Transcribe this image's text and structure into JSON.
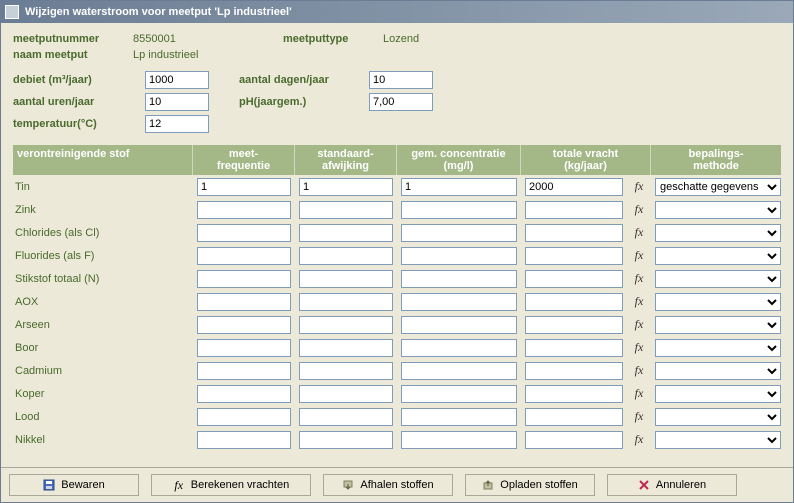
{
  "window": {
    "title": "Wijzigen waterstroom voor meetput 'Lp industrieel'"
  },
  "meta": {
    "meetputnummer_label": "meetputnummer",
    "meetputnummer": "8550001",
    "meetputtype_label": "meetputtype",
    "meetputtype": "Lozend",
    "naam_meetput_label": "naam meetput",
    "naam_meetput": "Lp industrieel",
    "debiet_label": "debiet (m³/jaar)",
    "debiet": "1000",
    "aantal_dagen_label": "aantal dagen/jaar",
    "aantal_dagen": "10",
    "aantal_uren_label": "aantal uren/jaar",
    "aantal_uren": "10",
    "ph_label": "pH(jaargem.)",
    "ph": "7,00",
    "temperatuur_label": "temperatuur(°C)",
    "temperatuur": "12"
  },
  "columns": {
    "stof": "verontreinigende stof",
    "freq": "meet-\nfrequentie",
    "afw": "standaard-\nafwijking",
    "conc": "gem. concentratie\n(mg/l)",
    "vracht": "totale vracht\n(kg/jaar)",
    "methode": "bepalings-\nmethode"
  },
  "methode_option": "geschatte gegevens",
  "rows": [
    {
      "stof": "Tin",
      "freq": "1",
      "afw": "1",
      "conc": "1",
      "vracht": "2000",
      "methode": "geschatte gegevens"
    },
    {
      "stof": "Zink",
      "freq": "",
      "afw": "",
      "conc": "",
      "vracht": "",
      "methode": ""
    },
    {
      "stof": "Chlorides (als Cl)",
      "freq": "",
      "afw": "",
      "conc": "",
      "vracht": "",
      "methode": ""
    },
    {
      "stof": "Fluorides (als F)",
      "freq": "",
      "afw": "",
      "conc": "",
      "vracht": "",
      "methode": ""
    },
    {
      "stof": "Stikstof totaal (N)",
      "freq": "",
      "afw": "",
      "conc": "",
      "vracht": "",
      "methode": ""
    },
    {
      "stof": "AOX",
      "freq": "",
      "afw": "",
      "conc": "",
      "vracht": "",
      "methode": ""
    },
    {
      "stof": "Arseen",
      "freq": "",
      "afw": "",
      "conc": "",
      "vracht": "",
      "methode": ""
    },
    {
      "stof": "Boor",
      "freq": "",
      "afw": "",
      "conc": "",
      "vracht": "",
      "methode": ""
    },
    {
      "stof": "Cadmium",
      "freq": "",
      "afw": "",
      "conc": "",
      "vracht": "",
      "methode": ""
    },
    {
      "stof": "Koper",
      "freq": "",
      "afw": "",
      "conc": "",
      "vracht": "",
      "methode": ""
    },
    {
      "stof": "Lood",
      "freq": "",
      "afw": "",
      "conc": "",
      "vracht": "",
      "methode": ""
    },
    {
      "stof": "Nikkel",
      "freq": "",
      "afw": "",
      "conc": "",
      "vracht": "",
      "methode": ""
    }
  ],
  "buttons": {
    "bewaren": "Bewaren",
    "bereken": "Berekenen vrachten",
    "afhalen": "Afhalen stoffen",
    "opladen": "Opladen stoffen",
    "annuleren": "Annuleren"
  }
}
